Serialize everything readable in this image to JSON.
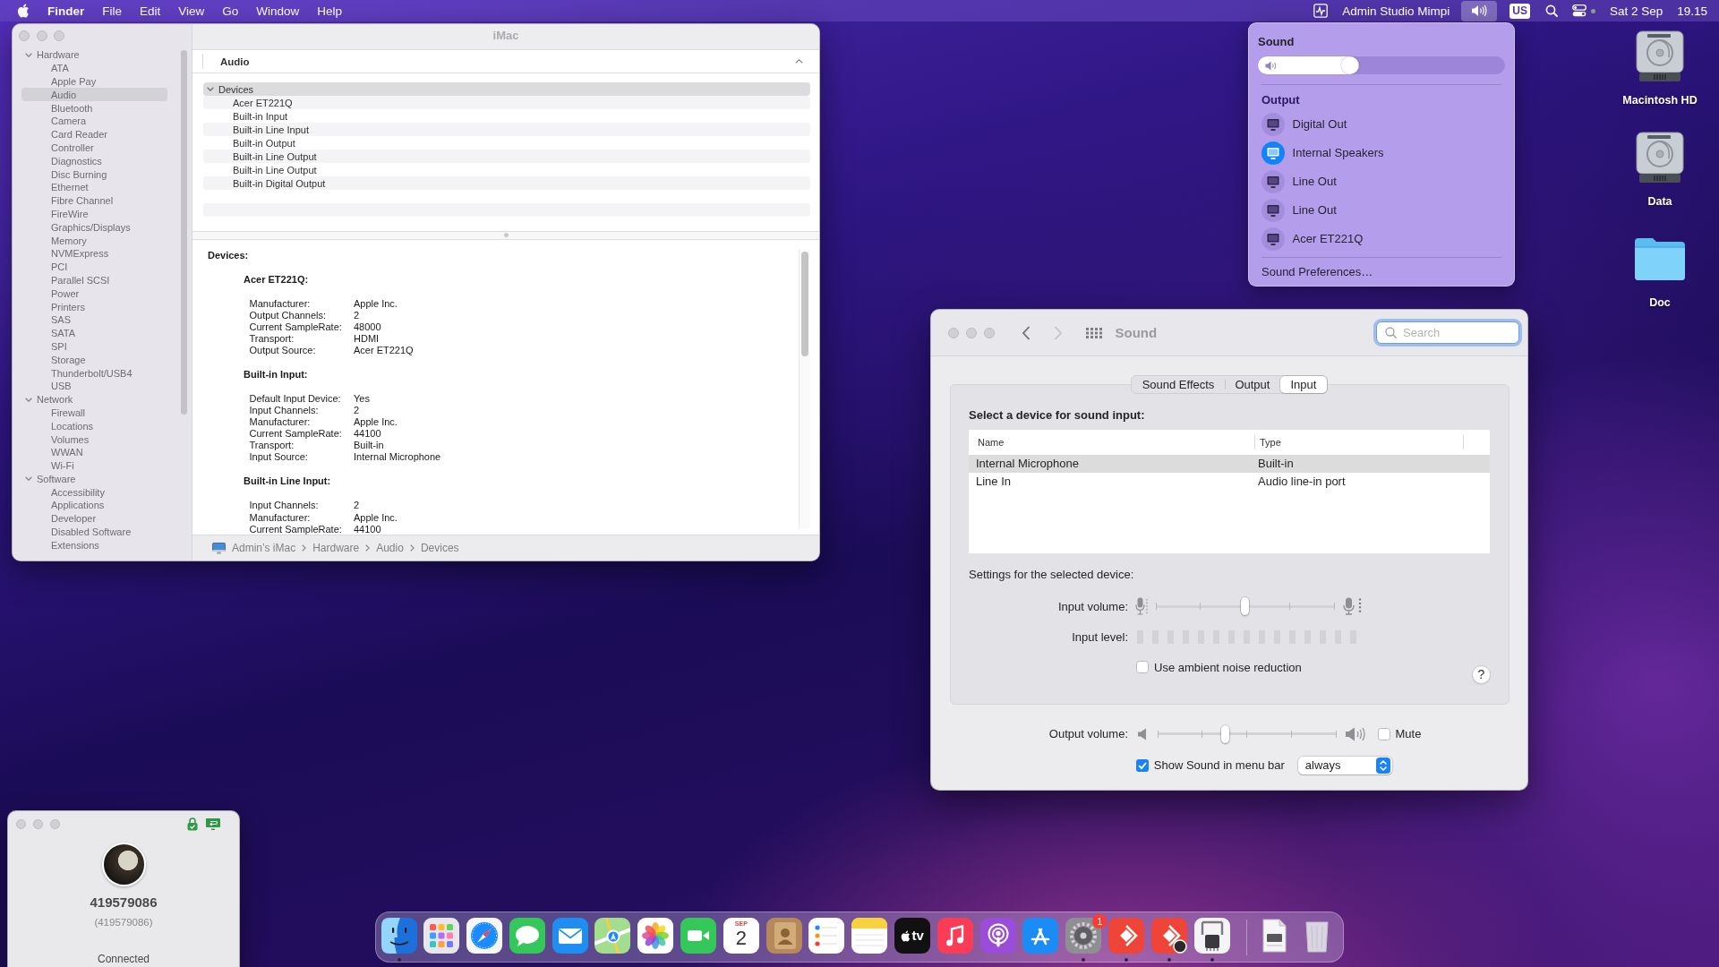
{
  "menu_bar": {
    "app_name": "Finder",
    "menus": [
      "File",
      "Edit",
      "View",
      "Go",
      "Window",
      "Help"
    ],
    "extras": [
      {
        "kind": "activity",
        "selected": false
      },
      {
        "kind": "text",
        "label": "Admin Studio Mimpi",
        "selected": false
      },
      {
        "kind": "sound",
        "selected": true
      },
      {
        "kind": "input_source",
        "label": "US",
        "selected": false
      },
      {
        "kind": "search",
        "selected": false
      },
      {
        "kind": "control_center",
        "selected": false
      },
      {
        "kind": "text",
        "label": "Sat 2 Sep",
        "selected": false
      },
      {
        "kind": "text",
        "label": "19.15",
        "selected": false
      }
    ]
  },
  "system_info": {
    "title": "iMac",
    "sidebar": [
      {
        "label": "Hardware",
        "expanded": true,
        "selected": false,
        "children": [
          {
            "label": "ATA",
            "selected": false
          },
          {
            "label": "Apple Pay",
            "selected": false
          },
          {
            "label": "Audio",
            "selected": true
          },
          {
            "label": "Bluetooth",
            "selected": false
          },
          {
            "label": "Camera",
            "selected": false
          },
          {
            "label": "Card Reader",
            "selected": false
          },
          {
            "label": "Controller",
            "selected": false
          },
          {
            "label": "Diagnostics",
            "selected": false
          },
          {
            "label": "Disc Burning",
            "selected": false
          },
          {
            "label": "Ethernet",
            "selected": false
          },
          {
            "label": "Fibre Channel",
            "selected": false
          },
          {
            "label": "FireWire",
            "selected": false
          },
          {
            "label": "Graphics/Displays",
            "selected": false
          },
          {
            "label": "Memory",
            "selected": false
          },
          {
            "label": "NVMExpress",
            "selected": false
          },
          {
            "label": "PCI",
            "selected": false
          },
          {
            "label": "Parallel SCSI",
            "selected": false
          },
          {
            "label": "Power",
            "selected": false
          },
          {
            "label": "Printers",
            "selected": false
          },
          {
            "label": "SAS",
            "selected": false
          },
          {
            "label": "SATA",
            "selected": false
          },
          {
            "label": "SPI",
            "selected": false
          },
          {
            "label": "Storage",
            "selected": false
          },
          {
            "label": "Thunderbolt/USB4",
            "selected": false
          },
          {
            "label": "USB",
            "selected": false
          }
        ]
      },
      {
        "label": "Network",
        "expanded": true,
        "selected": false,
        "children": [
          {
            "label": "Firewall",
            "selected": false
          },
          {
            "label": "Locations",
            "selected": false
          },
          {
            "label": "Volumes",
            "selected": false
          },
          {
            "label": "WWAN",
            "selected": false
          },
          {
            "label": "Wi-Fi",
            "selected": false
          }
        ]
      },
      {
        "label": "Software",
        "expanded": true,
        "selected": false,
        "children": [
          {
            "label": "Accessibility",
            "selected": false
          },
          {
            "label": "Applications",
            "selected": false
          },
          {
            "label": "Developer",
            "selected": false
          },
          {
            "label": "Disabled Software",
            "selected": false
          },
          {
            "label": "Extensions",
            "selected": false
          }
        ]
      }
    ],
    "header": "Audio",
    "tree": [
      {
        "label": "Devices",
        "expanded": true,
        "selected": true,
        "children": [
          {
            "label": "Acer ET221Q",
            "selected": false
          },
          {
            "label": "Built-in Input",
            "selected": false
          },
          {
            "label": "Built-in Line Input",
            "selected": false
          },
          {
            "label": "Built-in Output",
            "selected": false
          },
          {
            "label": "Built-in Line Output",
            "selected": false
          },
          {
            "label": "Built-in Line Output",
            "selected": false
          },
          {
            "label": "Built-in Digital Output",
            "selected": false
          }
        ]
      }
    ],
    "detail": {
      "heading": "Devices:",
      "sections": [
        {
          "title": "Acer ET221Q:",
          "fields": [
            {
              "label": "Manufacturer:",
              "value": "Apple Inc."
            },
            {
              "label": "Output Channels:",
              "value": "2"
            },
            {
              "label": "Current SampleRate:",
              "value": "48000"
            },
            {
              "label": "Transport:",
              "value": "HDMI"
            },
            {
              "label": "Output Source:",
              "value": "Acer ET221Q"
            }
          ]
        },
        {
          "title": "Built-in Input:",
          "fields": [
            {
              "label": "Default Input Device:",
              "value": "Yes"
            },
            {
              "label": "Input Channels:",
              "value": "2"
            },
            {
              "label": "Manufacturer:",
              "value": "Apple Inc."
            },
            {
              "label": "Current SampleRate:",
              "value": "44100"
            },
            {
              "label": "Transport:",
              "value": "Built-in"
            },
            {
              "label": "Input Source:",
              "value": "Internal Microphone"
            }
          ]
        },
        {
          "title": "Built-in Line Input:",
          "fields": [
            {
              "label": "Input Channels:",
              "value": "2"
            },
            {
              "label": "Manufacturer:",
              "value": "Apple Inc."
            },
            {
              "label": "Current SampleRate:",
              "value": "44100"
            }
          ]
        }
      ]
    },
    "breadcrumb": [
      "Admin’s iMac",
      "Hardware",
      "Audio",
      "Devices"
    ]
  },
  "sound_menu": {
    "title": "Sound",
    "volume": {
      "level": 0.41
    },
    "section": "Output",
    "devices": [
      {
        "name": "Digital Out",
        "selected": false
      },
      {
        "name": "Internal Speakers",
        "selected": true
      },
      {
        "name": "Line Out",
        "selected": false
      },
      {
        "name": "Line Out",
        "selected": false
      },
      {
        "name": "Acer ET221Q",
        "selected": false
      }
    ],
    "preferences": "Sound Preferences…"
  },
  "desktop_icons": [
    {
      "label": "Macintosh HD",
      "kind": "disk"
    },
    {
      "label": "Data",
      "kind": "disk"
    },
    {
      "label": "Doc",
      "kind": "folder"
    }
  ],
  "sound_prefs": {
    "title": "Sound",
    "back": {
      "disabled": false
    },
    "forward": {
      "disabled": true
    },
    "search": {
      "placeholder": "Search"
    },
    "tabs": [
      {
        "label": "Sound Effects",
        "selected": false
      },
      {
        "label": "Output",
        "selected": false
      },
      {
        "label": "Input",
        "selected": true
      }
    ],
    "prompt": "Select a device for sound input:",
    "table": {
      "columns": [
        "Name",
        "Type"
      ],
      "rows": [
        {
          "cells": [
            "Internal Microphone",
            "Built-in"
          ],
          "selected": true
        },
        {
          "cells": [
            "Line In",
            "Audio line-in port"
          ],
          "selected": false
        }
      ]
    },
    "settings_label": "Settings for the selected device:",
    "input_volume": {
      "label": "Input volume:",
      "level": 0.5
    },
    "input_level": {
      "label": "Input level:",
      "level": 0
    },
    "noise_reduction": {
      "label": "Use ambient noise reduction",
      "checked": false
    },
    "help": "?",
    "output_volume": {
      "label": "Output volume:",
      "level": 0.38
    },
    "mute": {
      "label": "Mute",
      "checked": false
    },
    "show_in_menu_bar": {
      "label": "Show Sound in menu bar",
      "checked": true
    },
    "show_mode": {
      "value": "always"
    }
  },
  "remote_window": {
    "name": "419579086",
    "alias": "(419579086)",
    "status": "Connected"
  },
  "dock": {
    "apps": [
      {
        "kind": "finder",
        "running": true
      },
      {
        "kind": "launchpad",
        "running": false
      },
      {
        "kind": "safari",
        "running": false
      },
      {
        "kind": "messages",
        "running": false
      },
      {
        "kind": "mail",
        "running": false
      },
      {
        "kind": "maps",
        "running": false
      },
      {
        "kind": "photos",
        "running": false
      },
      {
        "kind": "facetime",
        "running": false
      },
      {
        "kind": "calendar",
        "month": "SEP",
        "day": "2",
        "running": false
      },
      {
        "kind": "contacts",
        "running": false
      },
      {
        "kind": "reminders",
        "running": false
      },
      {
        "kind": "notes",
        "running": false
      },
      {
        "kind": "tv",
        "label": "tv",
        "running": false
      },
      {
        "kind": "music",
        "running": false
      },
      {
        "kind": "podcasts",
        "running": false
      },
      {
        "kind": "app_store",
        "running": false
      },
      {
        "kind": "system_preferences",
        "badge": "1",
        "running": true
      },
      {
        "kind": "anydesk",
        "running": true
      },
      {
        "kind": "anydesk_session",
        "running": true
      },
      {
        "kind": "system_information",
        "running": true
      }
    ],
    "others": [
      {
        "kind": "document"
      },
      {
        "kind": "trash"
      }
    ]
  }
}
